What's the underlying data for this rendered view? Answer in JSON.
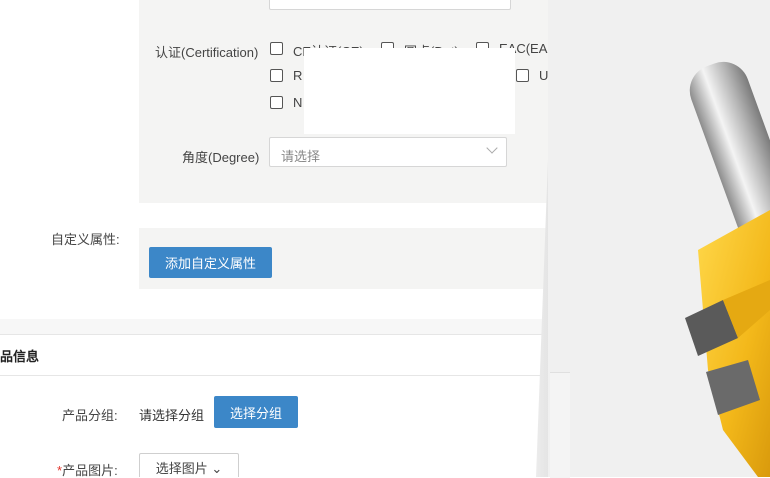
{
  "attributes": {
    "certification_label": "认证(Certification)",
    "cert_options": [
      "CE认证(CE)",
      "圆点(Dot)",
      "EAC(EAC)",
      "R",
      "UL",
      "N"
    ],
    "degree_label": "角度(Degree)",
    "degree_placeholder": "请选择"
  },
  "custom_attributes": {
    "label": "自定义属性:",
    "add_button": "添加自定义属性"
  },
  "product_info": {
    "section_title": "品信息",
    "group_label": "产品分组:",
    "group_placeholder": "请选择分组",
    "group_button": "选择分组",
    "image_required_mark": "*",
    "image_label": "产品图片:",
    "image_button": "选择图片"
  },
  "colors": {
    "primary": "#3c87c8",
    "required": "#e2332a",
    "panel_bg": "#f4f4f3",
    "product_yellow": "#f3b81a",
    "product_silver": "#b9b9b9"
  }
}
